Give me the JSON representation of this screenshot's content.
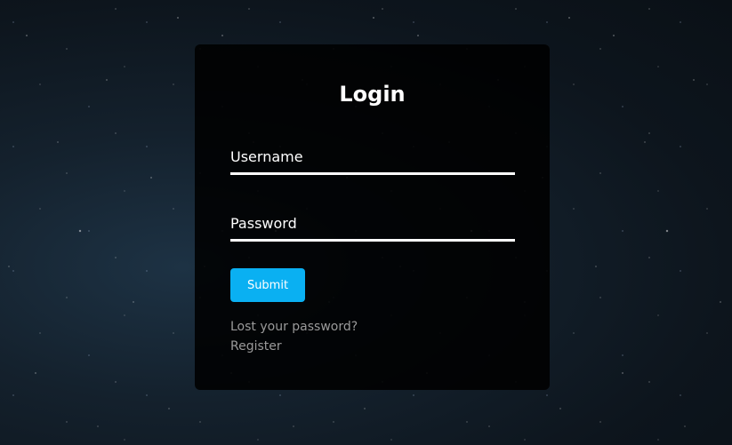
{
  "login": {
    "title": "Login",
    "username_placeholder": "Username",
    "password_placeholder": "Password",
    "submit_label": "Submit",
    "lost_password_link": "Lost your password?",
    "register_link": "Register"
  },
  "colors": {
    "card_background": "#000000",
    "accent": "#0ab0f2",
    "link": "#9a9a9a",
    "text": "#ffffff"
  }
}
